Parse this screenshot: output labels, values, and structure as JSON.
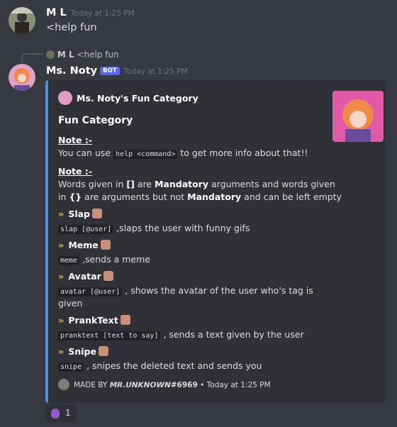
{
  "msg1": {
    "username": "M L",
    "timestamp": "Today at 1:25 PM",
    "text": "<help fun"
  },
  "reply": {
    "username": "M L",
    "text": "<help fun"
  },
  "msg2": {
    "username": "Ms. Noty",
    "bot_tag": "BOT",
    "timestamp": "Today at 1:25 PM"
  },
  "embed": {
    "author": "Ms. Noty's Fun Category",
    "title": "Fun Category",
    "note1_label": "Note :-",
    "note1_pre": "You can use ",
    "note1_code": "help <command>",
    "note1_post": " to get more info about that!!",
    "note2_label": "Note :-",
    "note2_l1_a": "Words given in ",
    "note2_l1_sym": "[]",
    "note2_l1_b": " are ",
    "note2_l1_bold": "Mandatory",
    "note2_l1_c": " arguments and words given",
    "note2_l2_a": "in ",
    "note2_l2_sym": "{}",
    "note2_l2_b": " are arguments but not ",
    "note2_l2_bold": "Mandatory",
    "note2_l2_c": " and can be left empty",
    "commands": [
      {
        "name": "Slap",
        "code": "slap [@user]",
        "desc": " ,slaps the user with funny gifs"
      },
      {
        "name": "Meme",
        "code": "meme",
        "desc": " ,sends a meme"
      },
      {
        "name": "Avatar",
        "code": "avatar [@user]",
        "desc": " , shows the avatar of the user who's tag is",
        "desc2": "given"
      },
      {
        "name": "PrankText",
        "code": "pranktext [text to say]",
        "desc": " , sends a text given by the user"
      },
      {
        "name": "Snipe",
        "code": "snipe",
        "desc": " , snipes the deleted text and sends you"
      }
    ],
    "footer_pre": "MADE BY ",
    "footer_name": "𝙈𝙍.𝙐𝙉𝙆𝙉𝙊𝙒𝙉#6969",
    "footer_sep": " • ",
    "footer_time": "Today at 1:25 PM"
  },
  "reaction": {
    "count": "1"
  },
  "colors": {
    "accent": "#4a90e2",
    "bot": "#5865f2",
    "chevron": "#f0b232"
  }
}
